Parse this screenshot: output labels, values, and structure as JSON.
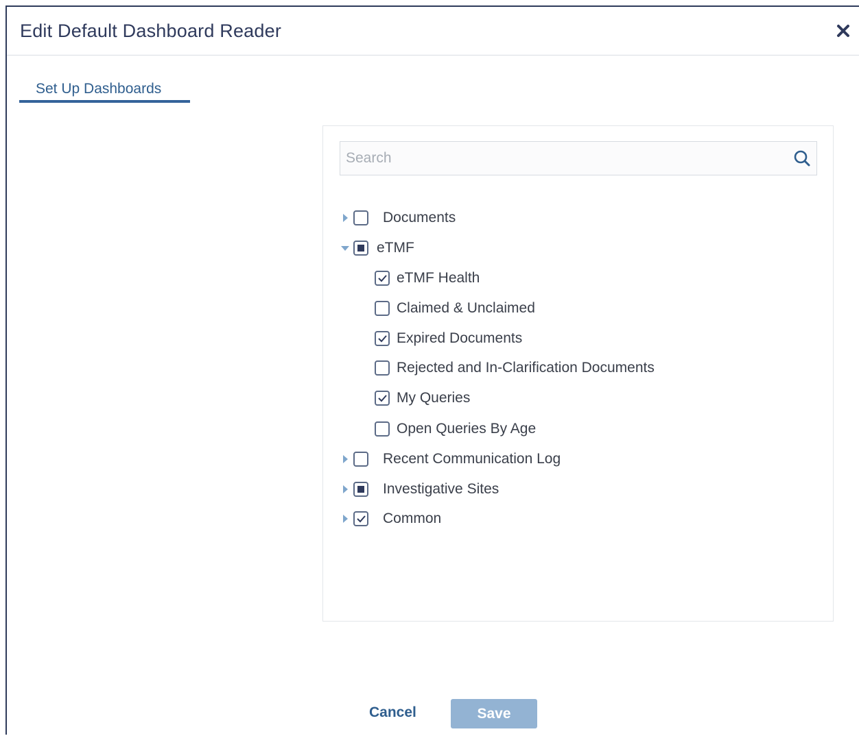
{
  "dialog": {
    "title": "Edit Default Dashboard Reader",
    "close_icon": "close-icon"
  },
  "tabs": [
    {
      "label": "Set Up Dashboards",
      "active": true
    }
  ],
  "search": {
    "placeholder": "Search",
    "value": "",
    "icon": "search-icon"
  },
  "tree": {
    "documents": {
      "label": "Documents",
      "state": "unchecked",
      "expanded": false
    },
    "etmf": {
      "label": "eTMF",
      "state": "partial",
      "expanded": true,
      "children": [
        {
          "label": "eTMF Health",
          "state": "checked"
        },
        {
          "label": "Claimed & Unclaimed",
          "state": "unchecked"
        },
        {
          "label": "Expired Documents",
          "state": "checked"
        },
        {
          "label": "Rejected and In-Clarification Documents",
          "state": "unchecked"
        },
        {
          "label": "My Queries",
          "state": "checked"
        },
        {
          "label": "Open Queries By Age",
          "state": "unchecked"
        }
      ]
    },
    "recent_communication_log": {
      "label": "Recent Communication Log",
      "state": "unchecked",
      "expanded": false
    },
    "investigative_sites": {
      "label": "Investigative Sites",
      "state": "partial",
      "expanded": false
    },
    "common": {
      "label": "Common",
      "state": "checked",
      "expanded": false
    }
  },
  "footer": {
    "cancel_label": "Cancel",
    "save_label": "Save"
  },
  "colors": {
    "title": "#2f3a5c",
    "accent": "#34639a",
    "save_button": "#93b3d3",
    "caret": "#7fa6cc"
  }
}
